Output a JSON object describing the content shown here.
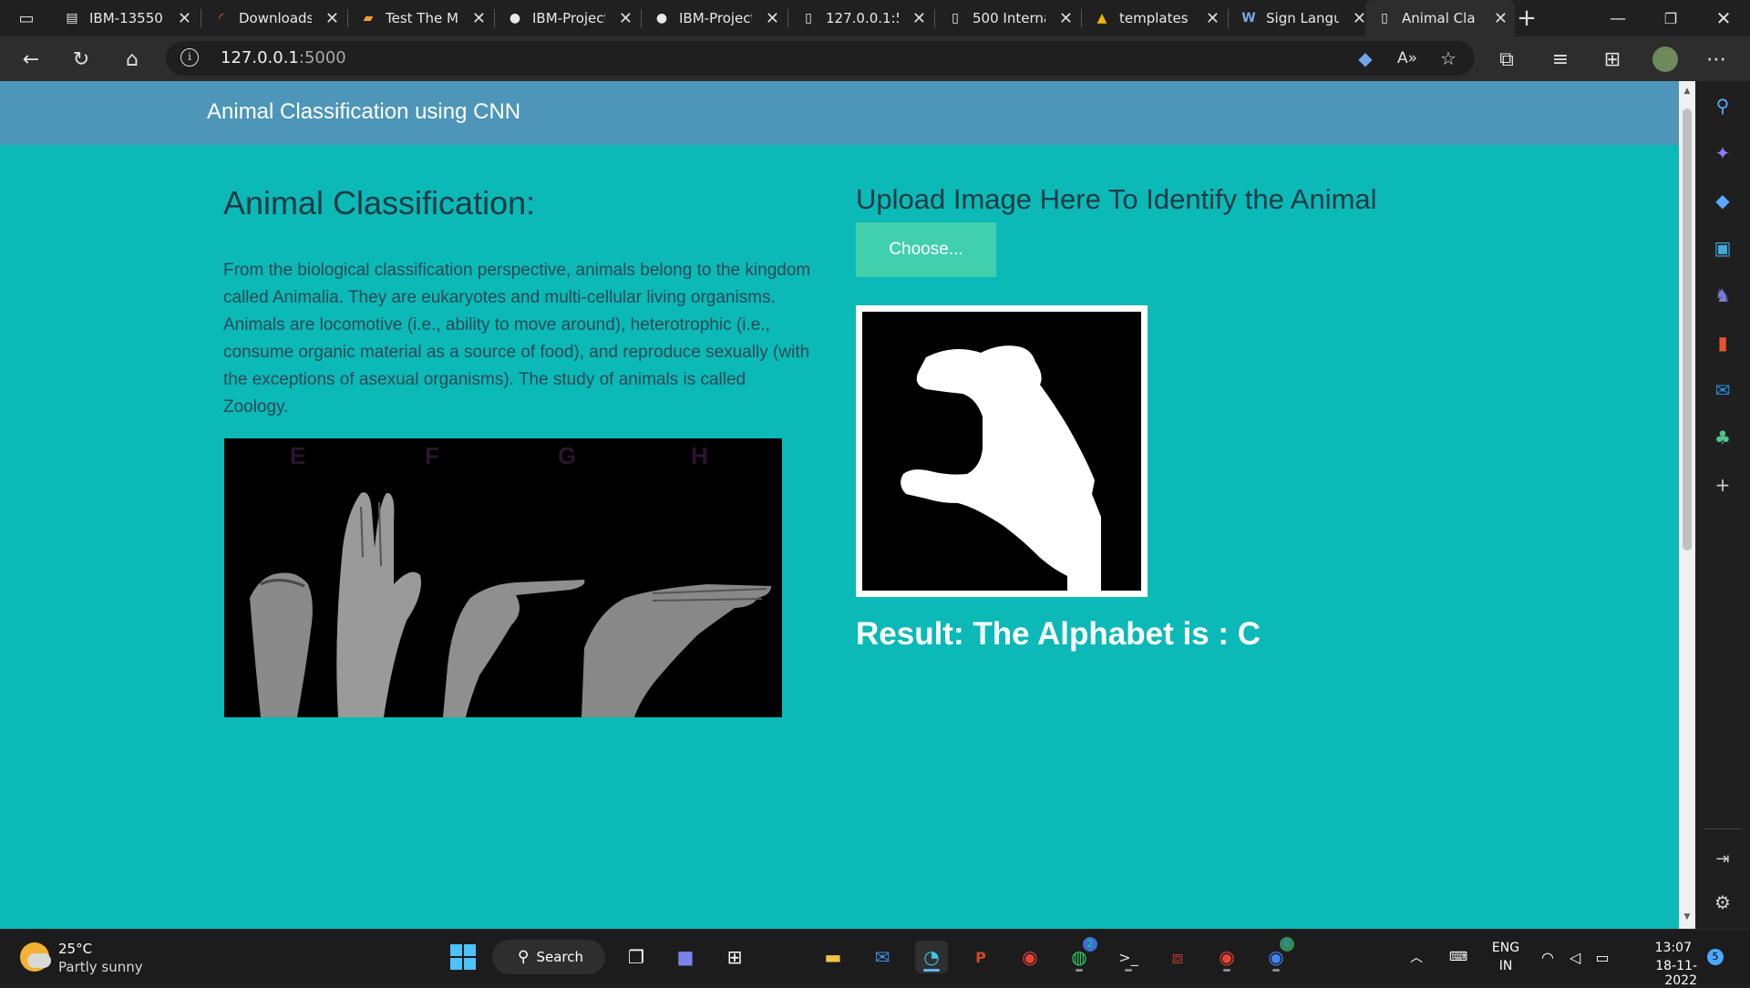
{
  "tabs": [
    {
      "title": "IBM-13550-",
      "icon": "document-icon"
    },
    {
      "title": "Downloads",
      "icon": "loading-icon"
    },
    {
      "title": "Test The Mc",
      "icon": "notebook-icon"
    },
    {
      "title": "IBM-Project",
      "icon": "github-icon"
    },
    {
      "title": "IBM-Project",
      "icon": "github-icon"
    },
    {
      "title": "127.0.0.1:50",
      "icon": "page-icon"
    },
    {
      "title": "500 Interna",
      "icon": "page-icon"
    },
    {
      "title": "templates -",
      "icon": "drive-icon"
    },
    {
      "title": "Sign Langu",
      "icon": "wikipedia-icon"
    },
    {
      "title": "Animal Clas",
      "icon": "page-icon"
    }
  ],
  "address": {
    "host": "127.0.0.1",
    "port": ":5000"
  },
  "page": {
    "navbar_title": "Animal Classification using CNN",
    "heading": "Animal Classification:",
    "paragraph": "From the biological classification perspective, animals belong to the kingdom called Animalia. They are eukaryotes and multi-cellular living organisms. Animals are locomotive (i.e., ability to move around), heterotrophic (i.e., consume organic material as a source of food), and reproduce sexually (with the exceptions of asexual organisms). The study of animals is called Zoology.",
    "image_letters": [
      "E",
      "F",
      "G",
      "H"
    ],
    "upload_heading": "Upload Image Here To Identify the Animal",
    "choose_button": "Choose...",
    "result": "Result: The Alphabet is : C"
  },
  "colors": {
    "page_bg": "#0bb9b7",
    "navbar_bg": "#4d96b9",
    "button_bg": "#41d0ae"
  },
  "taskbar": {
    "weather_temp": "25°C",
    "weather_desc": "Partly sunny",
    "search_label": "Search",
    "whatsapp_badge": "2",
    "chrome_badge": "E",
    "lang_1": "ENG",
    "lang_2": "IN",
    "time": "13:07",
    "date": "18-11-2022",
    "notif_count": "5"
  }
}
